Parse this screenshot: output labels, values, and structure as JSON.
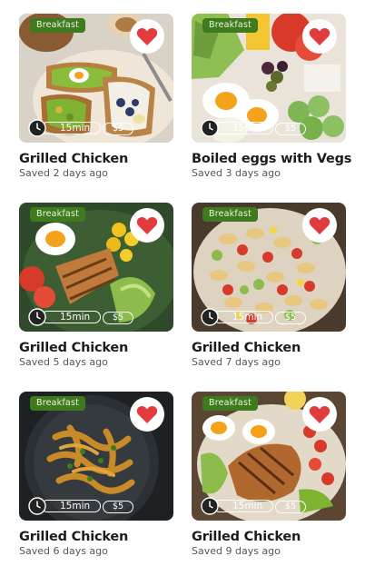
{
  "colors": {
    "tag_bg": "#3f7a1f",
    "heart": "#e33b3b",
    "title": "#1c1c1c",
    "subtitle": "#555555"
  },
  "icons": {
    "favorite": "heart-icon",
    "time": "clock-icon"
  },
  "recipes": [
    {
      "tag": "Breakfast",
      "time": "15min",
      "price": "$5",
      "title": "Grilled Chicken",
      "saved": "Saved 2 days ago",
      "favorited": true
    },
    {
      "tag": "Breakfast",
      "time": "15min",
      "price": "$5",
      "title": "Boiled eggs with Vegs",
      "saved": "Saved 3 days ago",
      "favorited": true
    },
    {
      "tag": "Breakfast",
      "time": "15min",
      "price": "$5",
      "title": "Grilled Chicken",
      "saved": "Saved 5 days ago",
      "favorited": true
    },
    {
      "tag": "Breakfast",
      "time": "15min",
      "price": "$5",
      "title": "Grilled Chicken",
      "saved": "Saved 7 days ago",
      "favorited": true
    },
    {
      "tag": "Breakfast",
      "time": "15min",
      "price": "$5",
      "title": "Grilled Chicken",
      "saved": "Saved 6 days ago",
      "favorited": true
    },
    {
      "tag": "Breakfast",
      "time": "15min",
      "price": "$5",
      "title": "Grilled Chicken",
      "saved": "Saved 9 days ago",
      "favorited": true
    }
  ]
}
